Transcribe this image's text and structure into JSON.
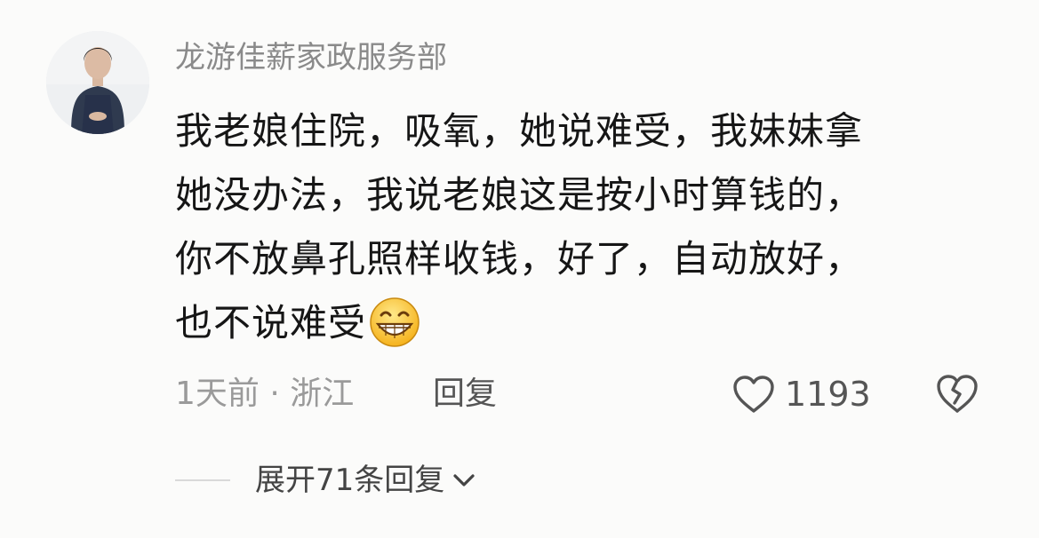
{
  "comment": {
    "author": "龙游佳薪家政服务部",
    "content_lines": [
      "我老娘住院，吸氧，她说难受，我妹妹拿",
      "她没办法，我说老娘这是按小时算钱的，",
      "你不放鼻孔照样收钱，好了，自动放好，",
      "也不说难受"
    ],
    "emoji": "grinning-face-emoji",
    "time_location": "1天前 · 浙江",
    "reply_label": "回复",
    "like_count": "1193",
    "expand_replies_label": "展开71条回复"
  },
  "icons": {
    "like": "heart-outline-icon",
    "dislike": "broken-heart-icon",
    "expand": "chevron-down-icon"
  },
  "colors": {
    "background": "#fbfbfa",
    "author": "#8a8a8a",
    "content": "#161616",
    "meta": "#9a9a9a"
  }
}
